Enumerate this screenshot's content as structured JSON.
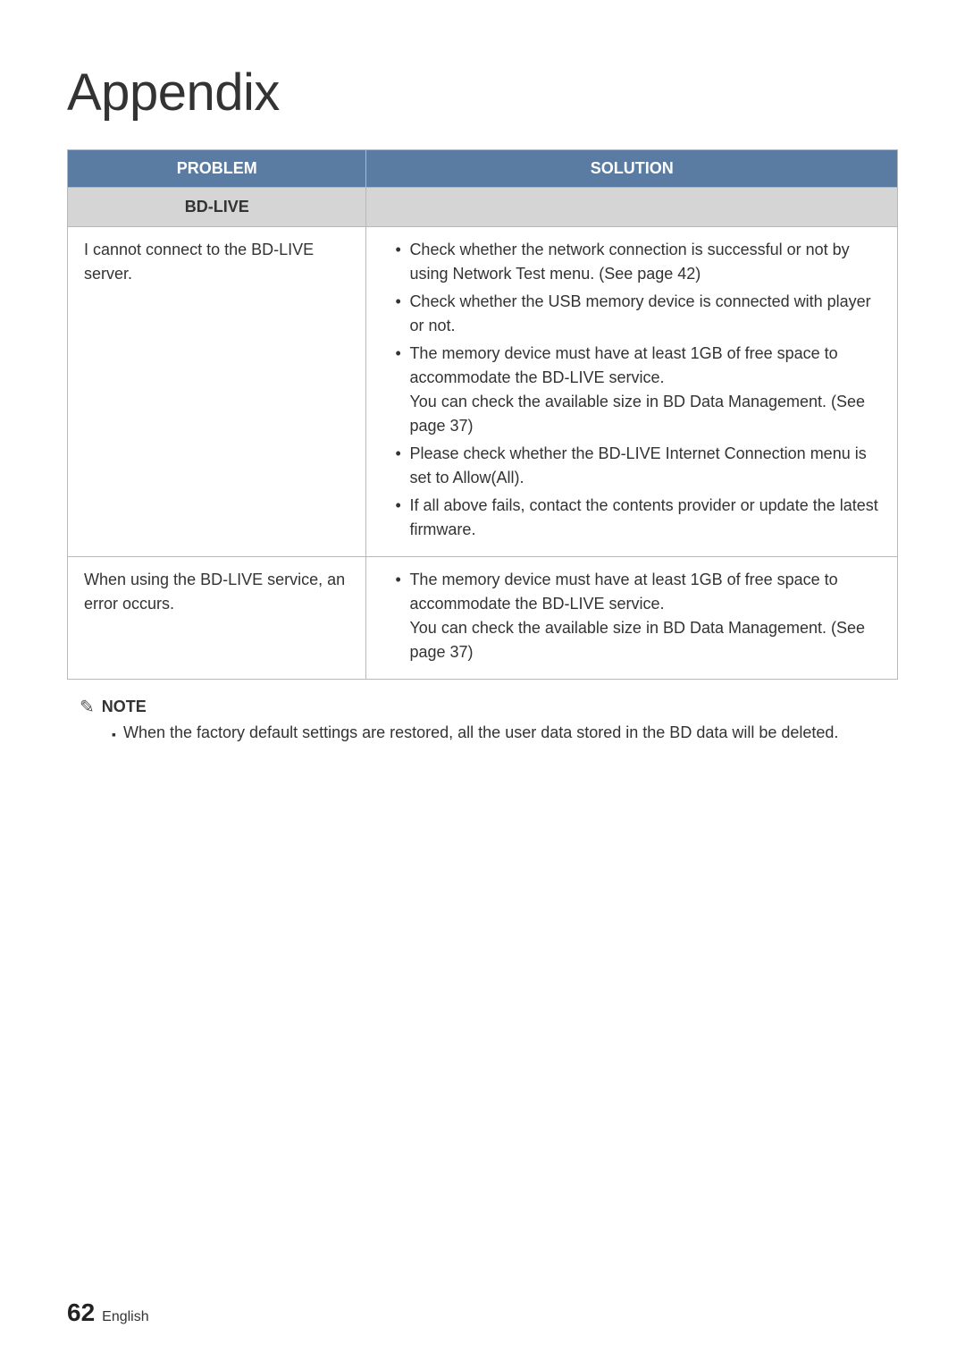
{
  "title": "Appendix",
  "table": {
    "headers": {
      "problem": "PROBLEM",
      "solution": "SOLUTION"
    },
    "subheader": "BD-LIVE",
    "rows": [
      {
        "problem": "I cannot connect to the BD-LIVE server.",
        "solution": [
          "Check whether the network connection is successful or not by using Network Test menu. (See page 42)",
          "Check whether the USB memory device is connected with player or not.",
          "The memory device must have at least 1GB of free space to accommodate the BD-LIVE service.\nYou can check the available size in BD Data Management. (See page 37)",
          "Please check whether the BD-LIVE Internet Connection menu is set to Allow(All).",
          "If all above fails, contact the contents provider or update the latest firmware."
        ]
      },
      {
        "problem": "When using the BD-LIVE service, an error occurs.",
        "solution": [
          "The memory device must have at least 1GB of free space to accommodate the BD-LIVE service.\nYou can check the available size in BD Data Management. (See page 37)"
        ]
      }
    ]
  },
  "note": {
    "label": "NOTE",
    "text": "When the factory default settings are restored, all the user data stored in the BD data will be deleted."
  },
  "footer": {
    "page": "62",
    "lang": "English"
  }
}
